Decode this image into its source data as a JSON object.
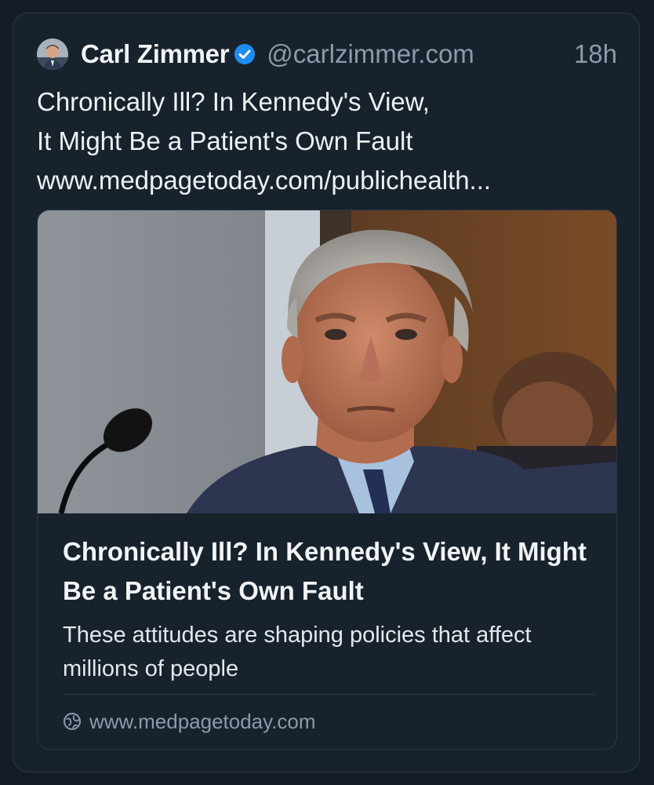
{
  "post": {
    "author": {
      "display_name": "Carl Zimmer",
      "handle": "@carlzimmer.com",
      "verified": true,
      "avatar_icon": "author-avatar"
    },
    "timestamp": "18h",
    "text_lines": [
      "Chronically Ill? In Kennedy's View,",
      "It Might Be a Patient's Own Fault",
      "www.medpagetoday.com/publichealth..."
    ]
  },
  "link_card": {
    "image_icon": "article-photo",
    "title": "Chronically Ill? In Kennedy's View, It Might Be a Patient's Own Fault",
    "description": "These attitudes are shaping policies that affect millions of people",
    "domain": "www.medpagetoday.com",
    "domain_icon": "globe-icon"
  },
  "colors": {
    "background": "#141c26",
    "card": "#18222d",
    "border": "#2a3644",
    "text_primary": "#f1f3f5",
    "text_secondary": "#8c9aab",
    "verified_blue": "#1d8cf0"
  }
}
